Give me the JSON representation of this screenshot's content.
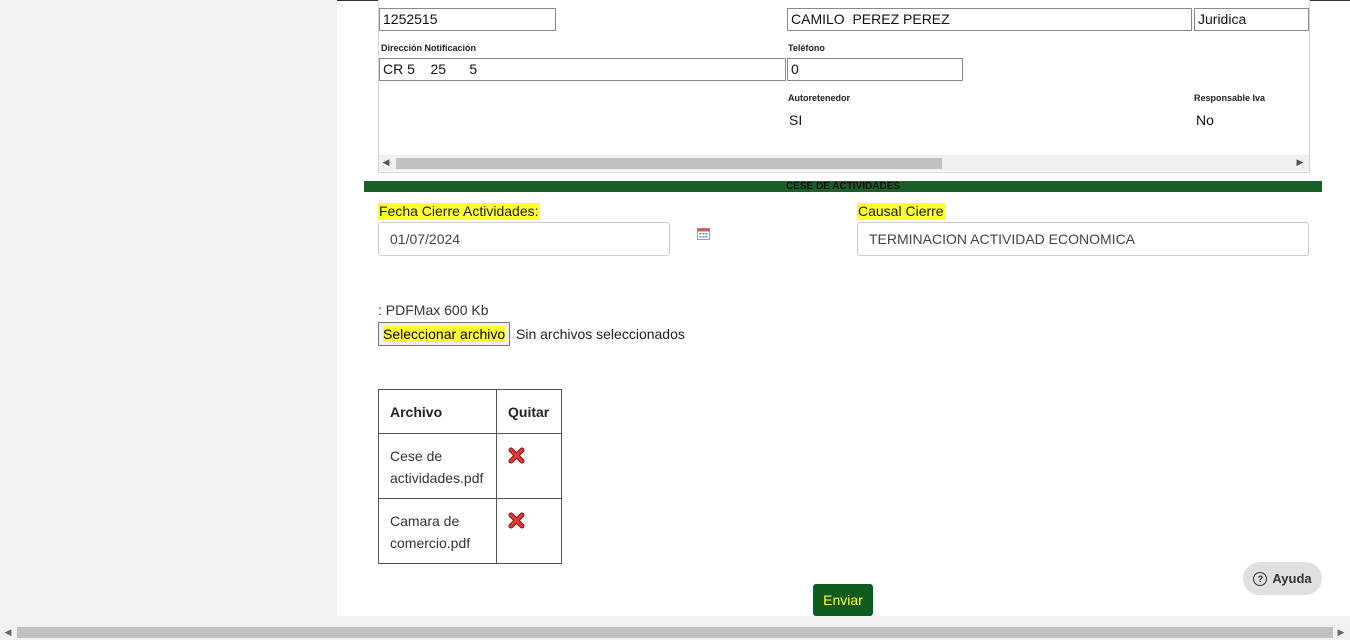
{
  "contributor": {
    "document_number": "1252515",
    "name": "CAMILO  PEREZ PEREZ",
    "person_type": "Juridica",
    "address_label": "Dirección Notificación",
    "address": "CR 5    25      5",
    "phone_label": "Teléfono",
    "phone": "0",
    "self_withholding_label": "Autoretenedor",
    "self_withholding": "SI",
    "vat_responsible_label": "Responsable Iva",
    "vat_responsible": "No"
  },
  "section": {
    "title": "CESE DE ACTIVIDADES"
  },
  "closure": {
    "date_label": "Fecha Cierre Actividades:",
    "date_value": "01/07/2024",
    "cause_label": "Causal Cierre",
    "cause_value": "TERMINACION ACTIVIDAD ECONOMICA"
  },
  "upload": {
    "note": ": PDFMax 600 Kb",
    "button_label": "Seleccionar archivo",
    "status": "Sin archivos seleccionados"
  },
  "files_table": {
    "headers": [
      "Archivo",
      "Quitar"
    ],
    "rows": [
      {
        "name": "Cese de actividades.pdf"
      },
      {
        "name": "Camara de comercio.pdf"
      }
    ]
  },
  "actions": {
    "submit_label": "Enviar",
    "help_label": "Ayuda"
  },
  "colors": {
    "section_bar": "#1b5e2a",
    "highlight": "#ffff33",
    "submit_bg": "#0f5a1e",
    "remove_icon": "#cc1f1f"
  },
  "icons": [
    "calendar-icon",
    "remove-x-icon",
    "help-circle-icon",
    "scroll-left-arrow-icon",
    "scroll-right-arrow-icon"
  ]
}
